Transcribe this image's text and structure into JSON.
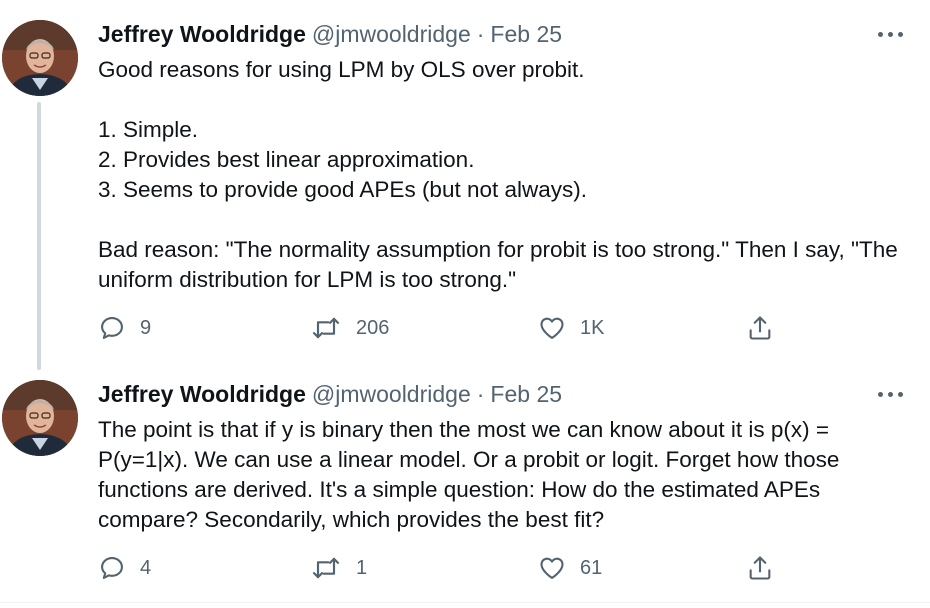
{
  "tweets": [
    {
      "author_name": "Jeffrey Wooldridge",
      "handle": "@jmwooldridge",
      "separator": "·",
      "date": "Feb 25",
      "text": "Good reasons for using LPM by OLS over probit.\n\n1. Simple.\n2. Provides best linear approximation.\n3. Seems to provide good APEs (but not always).\n\nBad reason: \"The normality assumption for probit is too strong.\" Then I say, \"The uniform distribution for LPM is too strong.\"",
      "replies": "9",
      "retweets": "206",
      "likes": "1K"
    },
    {
      "author_name": "Jeffrey Wooldridge",
      "handle": "@jmwooldridge",
      "separator": "·",
      "date": "Feb 25",
      "text": "The point is that if y is binary then the most we can know about it is p(x) = P(y=1|x). We can use a linear model. Or a probit or logit. Forget how those functions are derived. It's a simple question: How do the estimated APEs compare? Secondarily, which provides the best fit?",
      "replies": "4",
      "retweets": "1",
      "likes": "61"
    }
  ],
  "icons": {
    "reply": "reply-icon",
    "retweet": "retweet-icon",
    "like": "heart-icon",
    "share": "share-icon",
    "more": "more-icon"
  },
  "colors": {
    "text": "#0f1419",
    "secondary": "#536471",
    "thread_line": "#cfd9de"
  }
}
